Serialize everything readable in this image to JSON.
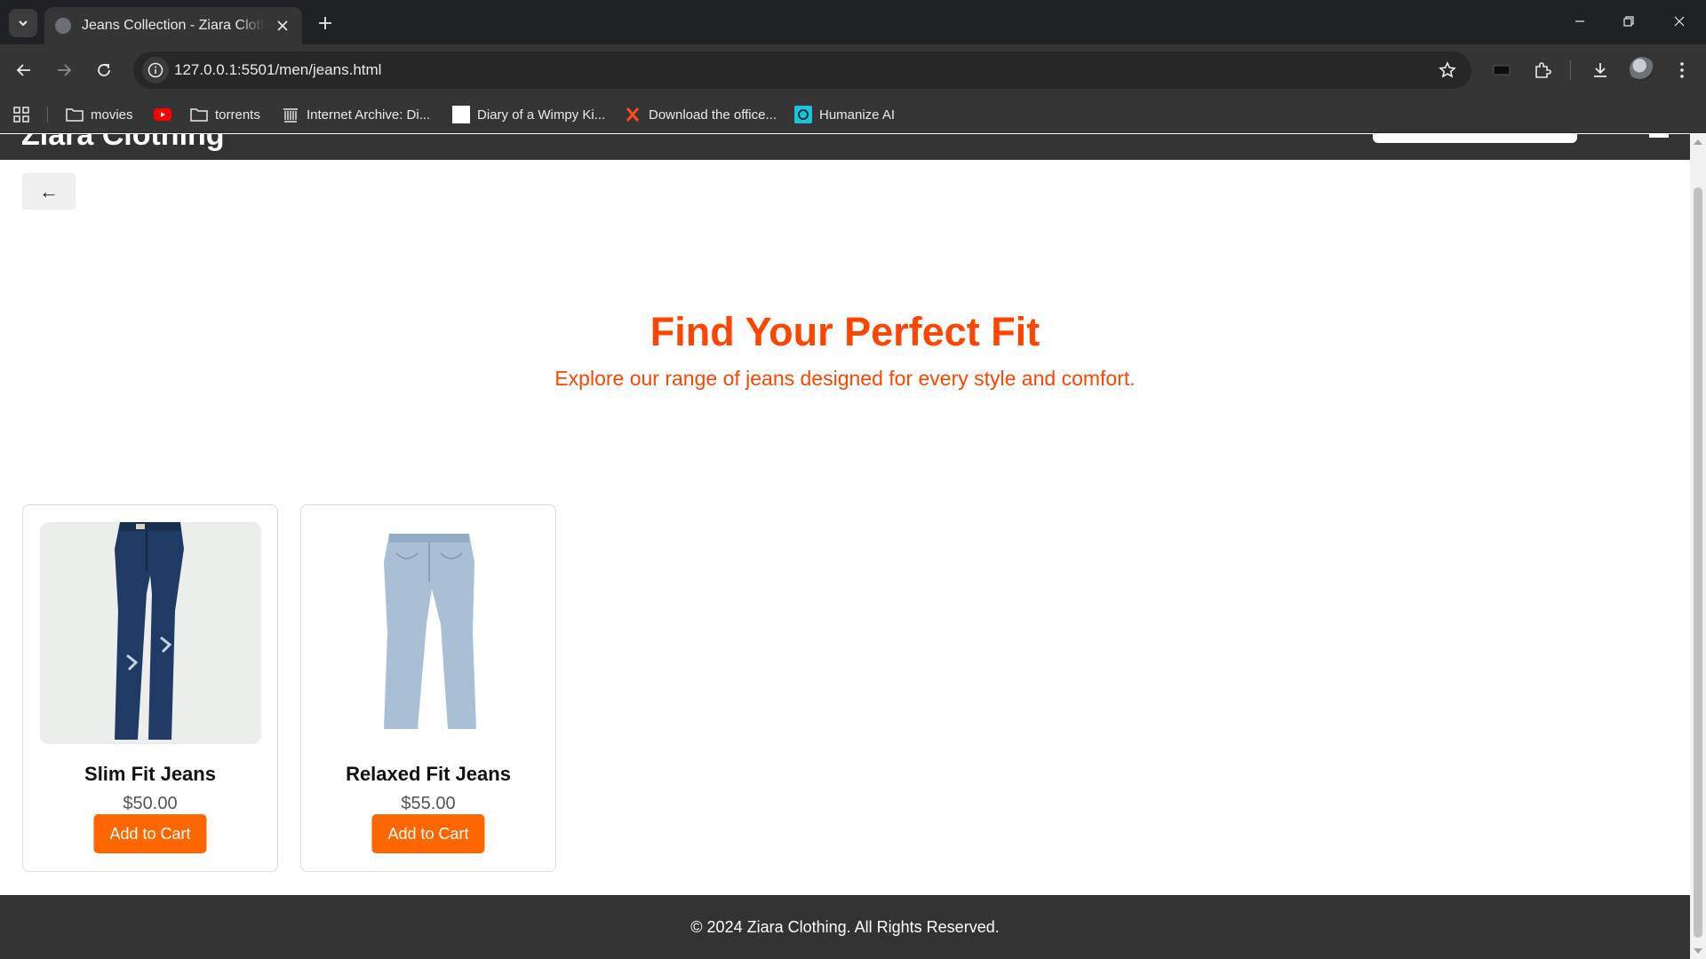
{
  "browser": {
    "tab_title": "Jeans Collection - Ziara Clothing",
    "url": "127.0.0.1:5501/men/jeans.html",
    "bookmarks": [
      {
        "label": "movies",
        "icon": "folder-icon"
      },
      {
        "label": "",
        "icon": "youtube-icon"
      },
      {
        "label": "torrents",
        "icon": "folder-icon"
      },
      {
        "label": "Internet Archive: Di...",
        "icon": "archive-icon"
      },
      {
        "label": "Diary of a Wimpy Ki...",
        "icon": "blank-page-icon"
      },
      {
        "label": "Download the office...",
        "icon": "x-logo-icon"
      },
      {
        "label": "Humanize AI",
        "icon": "humanize-icon"
      }
    ]
  },
  "site": {
    "logo": "Ziara Clothing",
    "back_label": "←",
    "hero_title": "Find Your Perfect Fit",
    "hero_subtitle": "Explore our range of jeans designed for every style and comfort.",
    "footer": "© 2024 Ziara Clothing. All Rights Reserved."
  },
  "products": [
    {
      "name": "Slim Fit Jeans",
      "price": "$50.00",
      "button": "Add to Cart",
      "color": "#1f3a63"
    },
    {
      "name": "Relaxed Fit Jeans",
      "price": "$55.00",
      "button": "Add to Cart",
      "color": "#a8bfd6"
    }
  ],
  "colors": {
    "accent": "#ff4500",
    "button": "#ff6600",
    "header_footer": "#333333"
  }
}
